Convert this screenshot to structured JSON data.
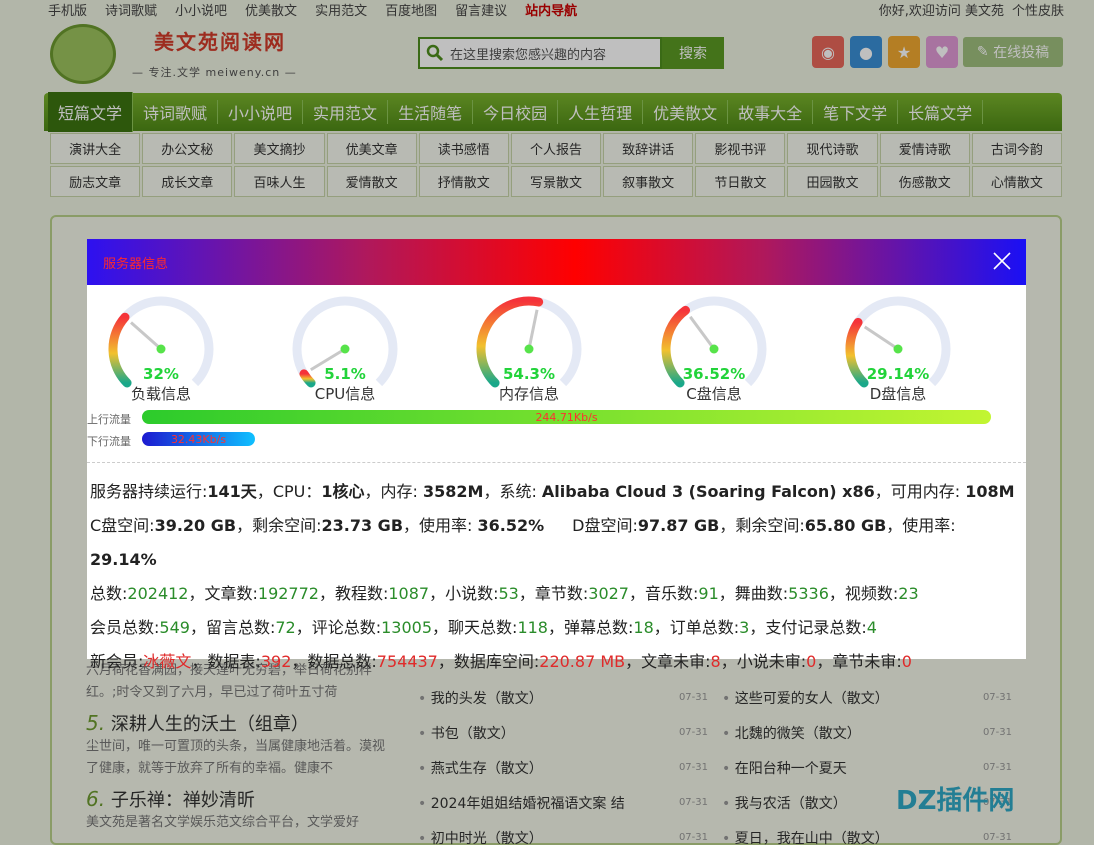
{
  "topbar": {
    "links": [
      "手机版",
      "诗词歌赋",
      "小小说吧",
      "优美散文",
      "实用范文",
      "百度地图",
      "留言建议",
      "站内导航"
    ],
    "greeting": "你好,欢迎访问 美文苑",
    "skin": "个性皮肤"
  },
  "logo": {
    "name": "美文苑阅读网",
    "slogan": "— 专注.文学 meiweny.cn —"
  },
  "search": {
    "placeholder": "在这里搜索您感兴趣的内容",
    "button": "搜索"
  },
  "submit_button": "在线投稿",
  "main_nav": [
    "短篇文学",
    "诗词歌赋",
    "小小说吧",
    "实用范文",
    "生活随笔",
    "今日校园",
    "人生哲理",
    "优美散文",
    "故事大全",
    "笔下文学",
    "长篇文学"
  ],
  "sub_nav": [
    "演讲大全",
    "办公文秘",
    "美文摘抄",
    "优美文章",
    "读书感悟",
    "个人报告",
    "致辞讲话",
    "影视书评",
    "现代诗歌",
    "爱情诗歌",
    "古词今韵",
    "励志文章",
    "成长文章",
    "百味人生",
    "爱情散文",
    "抒情散文",
    "写景散文",
    "叙事散文",
    "节日散文",
    "田园散文",
    "伤感散文",
    "心情散文"
  ],
  "left_col": {
    "p1": "六月荷花香满园，接天莲叶无穷碧，举日荷花别样红。;时令又到了六月，早已过了荷叶五寸荷",
    "h5_num": "5.",
    "h5": "深耕人生的沃土（组章）",
    "p2": "尘世间，唯一可置顶的头条，当属健康地活着。漠视了健康，就等于放弃了所有的幸福。健康不",
    "h6_num": "6.",
    "h6": "子乐禅：禅妙清昕",
    "p3": "美文苑是著名文学娱乐范文综合平台，文学爱好"
  },
  "list_left": [
    {
      "t": "我的头发（散文）",
      "d": "07-31"
    },
    {
      "t": "书包（散文）",
      "d": "07-31"
    },
    {
      "t": "燕式生存（散文）",
      "d": "07-31"
    },
    {
      "t": "2024年姐姐结婚祝福语文案 结",
      "d": "07-31"
    },
    {
      "t": "初中时光（散文）",
      "d": "07-31"
    }
  ],
  "list_right": [
    {
      "t": "这些可爱的女人（散文）",
      "d": "07-31"
    },
    {
      "t": "北魏的微笑（散文）",
      "d": "07-31"
    },
    {
      "t": "在阳台种一个夏天",
      "d": "07-31"
    },
    {
      "t": "我与农活（散文）",
      "d": "07-31"
    },
    {
      "t": "夏日，我在山中（散文）",
      "d": "07-31"
    }
  ],
  "watermark": "DZ插件网",
  "modal": {
    "title": "服务器信息",
    "gauges": [
      {
        "value": "32%",
        "label": "负载信息",
        "percent": 32
      },
      {
        "value": "5.1%",
        "label": "CPU信息",
        "percent": 5.1
      },
      {
        "value": "54.3%",
        "label": "内存信息",
        "percent": 54.3
      },
      {
        "value": "36.52%",
        "label": "C盘信息",
        "percent": 36.52
      },
      {
        "value": "29.14%",
        "label": "D盘信息",
        "percent": 29.14
      }
    ],
    "upload": {
      "label": "上行流量",
      "value": "244.71Kb/s"
    },
    "download": {
      "label": "下行流量",
      "value": "32.43Kb/s"
    },
    "stats": {
      "runtime_label": "服务器持续运行:",
      "runtime": "141天",
      "cpu_label": "，CPU：",
      "cpu": "1核心",
      "mem_label": "，内存: ",
      "mem": "3582M",
      "os_label": "，系统: ",
      "os": "Alibaba Cloud 3 (Soaring Falcon) x86",
      "freemem_label": "，可用内存: ",
      "freemem": "108M",
      "c_label": "C盘空间:",
      "c_total": "39.20 GB",
      "c_free_label": "，剩余空间:",
      "c_free": "23.73 GB",
      "c_use_label": "，使用率: ",
      "c_use": "36.52%",
      "d_label": "D盘空间:",
      "d_total": "97.87 GB",
      "d_free_label": "，剩余空间:",
      "d_free": "65.80 GB",
      "d_use_label": "，使用率: ",
      "d_use": "29.14%",
      "total_label": "总数:",
      "total": "202412",
      "articles_label": "，文章数:",
      "articles": "192772",
      "tutorials_label": "，教程数:",
      "tutorials": "1087",
      "novels_label": "，小说数:",
      "novels": "53",
      "chapters_label": "，章节数:",
      "chapters": "3027",
      "music_label": "，音乐数:",
      "music": "91",
      "dance_label": "，舞曲数:",
      "dance": "5336",
      "video_label": "，视频数:",
      "video": "23",
      "members_label": "会员总数:",
      "members": "549",
      "messages_label": "，留言总数:",
      "messages": "72",
      "comments_label": "，评论总数:",
      "comments": "13005",
      "chats_label": "，聊天总数:",
      "chats": "118",
      "danmaku_label": "，弹幕总数:",
      "danmaku": "18",
      "orders_label": "，订单总数:",
      "orders": "3",
      "payments_label": "，支付记录总数:",
      "payments": "4",
      "newmember_label": "新会员:",
      "newmember": "冰薇文",
      "tables_label": "，数据表:",
      "tables": "392",
      "rows_label": "，数据总数:",
      "rows": "754437",
      "dbsize_label": "，数据库空间:",
      "dbsize": "220.87 MB",
      "unreviewed_articles_label": "，文章未审:",
      "unreviewed_articles": "8",
      "unreviewed_novels_label": "，小说未审:",
      "unreviewed_novels": "0",
      "unreviewed_chapters_label": "，章节未审:",
      "unreviewed_chapters": "0"
    }
  },
  "colors": {
    "nav_green": "#4f8a16",
    "gauge_track": "#e4e9f5",
    "value_green": "#22d33a",
    "stat_green": "#2a8c2a",
    "stat_red": "#e02a2a"
  }
}
